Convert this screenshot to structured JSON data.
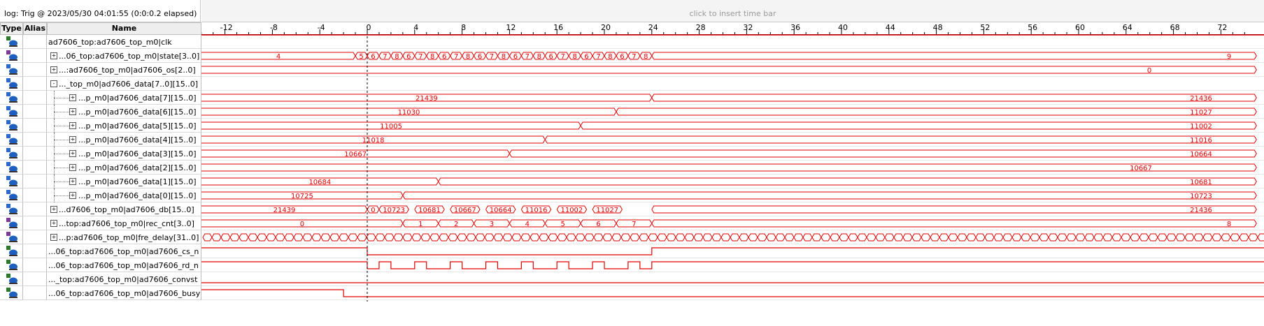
{
  "log_title": "log: Trig @ 2023/05/30 04:01:55 (0:0:0.2 elapsed)",
  "time_bar_hint": "click to insert time bar",
  "columns": {
    "type": "Type",
    "alias": "Alias",
    "name": "Name"
  },
  "time_axis": {
    "ticks": [
      "-12",
      "-8",
      "-4",
      "0",
      "4",
      "8",
      "12",
      "16",
      "20",
      "24",
      "28",
      "32",
      "36",
      "40",
      "44",
      "48",
      "52",
      "56",
      "60",
      "64",
      "68",
      "72"
    ]
  },
  "colors": {
    "wave": "#e00000",
    "cursor": "#000000",
    "grid": "#bdbdbd"
  },
  "signals": [
    {
      "name": "ad7606_top:ad7606_top_m0|clk",
      "type_icon": "input-pin-icon",
      "kind": "clock",
      "expander": "",
      "indent": 0
    },
    {
      "name": "...06_top:ad7606_top_m0|state[3..0]",
      "type_icon": "register-icon",
      "kind": "bus",
      "expander": "+",
      "indent": 0,
      "segments": [
        [
          "4",
          -15.5,
          -1
        ],
        [
          "5",
          -1,
          0
        ],
        [
          "6",
          0,
          1
        ],
        [
          "7",
          1,
          2
        ],
        [
          "8",
          2,
          3
        ],
        [
          "6",
          3,
          4
        ],
        [
          "7",
          4,
          5
        ],
        [
          "8",
          5,
          6
        ],
        [
          "6",
          6,
          7
        ],
        [
          "7",
          7,
          8
        ],
        [
          "8",
          8,
          9
        ],
        [
          "6",
          9,
          10
        ],
        [
          "7",
          10,
          11
        ],
        [
          "8",
          11,
          12
        ],
        [
          "6",
          12,
          13
        ],
        [
          "7",
          13,
          14
        ],
        [
          "8",
          14,
          15
        ],
        [
          "6",
          15,
          16
        ],
        [
          "7",
          16,
          17
        ],
        [
          "8",
          17,
          18
        ],
        [
          "6",
          18,
          19
        ],
        [
          "7",
          19,
          20
        ],
        [
          "8",
          20,
          21
        ],
        [
          "6",
          21,
          22
        ],
        [
          "7",
          22,
          23
        ],
        [
          "8",
          23,
          24
        ],
        [
          "9",
          24,
          75
        ]
      ]
    },
    {
      "name": "...:ad7606_top_m0|ad7606_os[2..0]",
      "type_icon": "combinational-icon",
      "kind": "bus",
      "expander": "+",
      "indent": 0,
      "segments": [
        [
          "0",
          -15.5,
          75
        ]
      ]
    },
    {
      "name": "..._top_m0|ad7606_data[7..0][15..0]",
      "type_icon": "combinational-icon",
      "kind": "empty",
      "expander": "-",
      "indent": 0
    },
    {
      "name": "...p_m0|ad7606_data[7][15..0]",
      "type_icon": "combinational-icon",
      "kind": "bus",
      "expander": "+",
      "indent": 2,
      "segments": [
        [
          "21439",
          -15.5,
          24
        ],
        [
          "21436",
          24,
          75
        ]
      ]
    },
    {
      "name": "...p_m0|ad7606_data[6][15..0]",
      "type_icon": "combinational-icon",
      "kind": "bus",
      "expander": "+",
      "indent": 2,
      "segments": [
        [
          "11030",
          -15.5,
          21
        ],
        [
          "11027",
          21,
          75
        ]
      ]
    },
    {
      "name": "...p_m0|ad7606_data[5][15..0]",
      "type_icon": "combinational-icon",
      "kind": "bus",
      "expander": "+",
      "indent": 2,
      "segments": [
        [
          "11005",
          -15.5,
          18
        ],
        [
          "11002",
          18,
          75
        ]
      ]
    },
    {
      "name": "...p_m0|ad7606_data[4][15..0]",
      "type_icon": "combinational-icon",
      "kind": "bus",
      "expander": "+",
      "indent": 2,
      "segments": [
        [
          "11018",
          -15.5,
          15
        ],
        [
          "11016",
          15,
          75
        ]
      ]
    },
    {
      "name": "...p_m0|ad7606_data[3][15..0]",
      "type_icon": "combinational-icon",
      "kind": "bus",
      "expander": "+",
      "indent": 2,
      "segments": [
        [
          "10667",
          -15.5,
          12
        ],
        [
          "10664",
          12,
          75
        ]
      ]
    },
    {
      "name": "...p_m0|ad7606_data[2][15..0]",
      "type_icon": "combinational-icon",
      "kind": "bus",
      "expander": "+",
      "indent": 2,
      "segments": [
        [
          "10667",
          -15.5,
          75
        ]
      ]
    },
    {
      "name": "...p_m0|ad7606_data[1][15..0]",
      "type_icon": "combinational-icon",
      "kind": "bus",
      "expander": "+",
      "indent": 2,
      "segments": [
        [
          "10684",
          -15.5,
          6
        ],
        [
          "10681",
          6,
          75
        ]
      ]
    },
    {
      "name": "...p_m0|ad7606_data[0][15..0]",
      "type_icon": "combinational-icon",
      "kind": "bus",
      "expander": "+",
      "indent": 2,
      "segments": [
        [
          "10725",
          -15.5,
          3
        ],
        [
          "10723",
          3,
          75
        ]
      ]
    },
    {
      "name": "...d7606_top_m0|ad7606_db[15..0]",
      "type_icon": "combinational-icon",
      "kind": "bus",
      "expander": "+",
      "indent": 0,
      "segments": [
        [
          "21439",
          -15.5,
          0
        ],
        [
          "0",
          0,
          1
        ],
        [
          "10723",
          1,
          3.5
        ],
        [
          "10681",
          4,
          6.5
        ],
        [
          "10667",
          7,
          9.5
        ],
        [
          "10664",
          10,
          12.5
        ],
        [
          "11016",
          13,
          15.5
        ],
        [
          "11002",
          16,
          18.5
        ],
        [
          "11027",
          19,
          21.5
        ],
        [
          "21436",
          24,
          75
        ]
      ]
    },
    {
      "name": "...top:ad7606_top_m0|rec_cnt[3..0]",
      "type_icon": "register-icon",
      "kind": "bus",
      "expander": "+",
      "indent": 0,
      "segments": [
        [
          "0",
          -15.5,
          3
        ],
        [
          "1",
          3,
          6
        ],
        [
          "2",
          6,
          9
        ],
        [
          "3",
          9,
          12
        ],
        [
          "4",
          12,
          15
        ],
        [
          "5",
          15,
          18
        ],
        [
          "6",
          18,
          21
        ],
        [
          "7",
          21,
          24
        ],
        [
          "8",
          24,
          75
        ]
      ]
    },
    {
      "name": "...p:ad7606_top_m0|fre_delay[31..0]",
      "type_icon": "register-icon",
      "kind": "busy-bus",
      "expander": "+",
      "indent": 0
    },
    {
      "name": "...06_top:ad7606_top_m0|ad7606_cs_n",
      "type_icon": "output-pin-icon",
      "kind": "cs",
      "expander": "",
      "indent": 0
    },
    {
      "name": "...06_top:ad7606_top_m0|ad7606_rd_n",
      "type_icon": "output-pin-icon",
      "kind": "rd",
      "expander": "",
      "indent": 0
    },
    {
      "name": "..._top:ad7606_top_m0|ad7606_convst",
      "type_icon": "output-pin-icon",
      "kind": "low",
      "expander": "",
      "indent": 0
    },
    {
      "name": "...06_top:ad7606_top_m0|ad7606_busy",
      "type_icon": "input-pin-icon",
      "kind": "busy",
      "expander": "",
      "indent": 0
    }
  ]
}
